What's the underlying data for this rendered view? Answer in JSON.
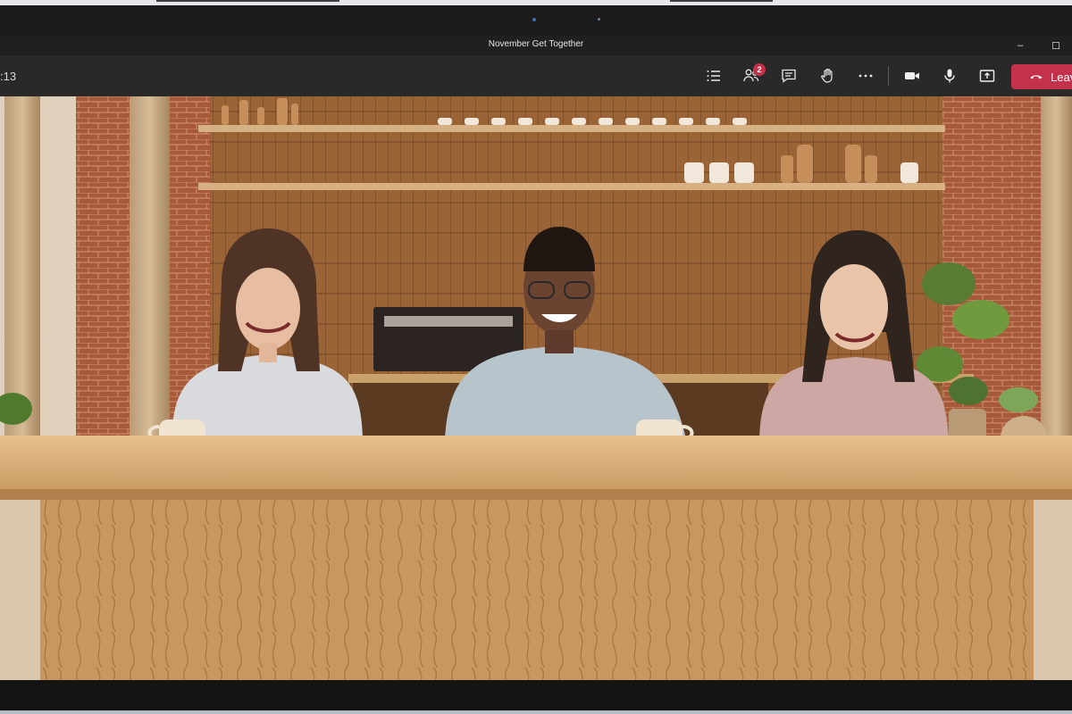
{
  "window": {
    "title": "November Get Together",
    "minimize_glyph": "–",
    "maximize_glyph": "☐"
  },
  "toolbar": {
    "call_timer": ":13",
    "participants_badge": "2",
    "leave_label": "Leave",
    "buttons": [
      {
        "name": "meeting-info",
        "icon": "list-icon"
      },
      {
        "name": "participants",
        "icon": "people-icon"
      },
      {
        "name": "chat",
        "icon": "chat-icon"
      },
      {
        "name": "raise-hand",
        "icon": "hand-icon"
      },
      {
        "name": "more-options",
        "icon": "ellipsis-icon"
      },
      {
        "name": "camera",
        "icon": "video-icon"
      },
      {
        "name": "microphone",
        "icon": "mic-icon"
      },
      {
        "name": "share",
        "icon": "share-icon"
      }
    ],
    "colors": {
      "leave": "#c4314b",
      "bar": "#292929",
      "badge": "#c4314b"
    }
  },
  "stage": {
    "mode": "Together mode",
    "scene": "cafe counter with brick walls and shelves",
    "participants_visible": 3
  }
}
